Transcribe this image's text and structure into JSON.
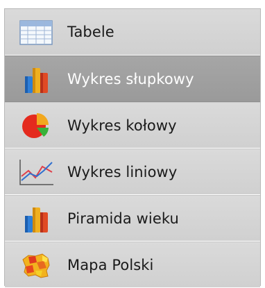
{
  "menu": {
    "active_index": 1,
    "items": [
      {
        "label": "Tabele",
        "icon": "table-icon"
      },
      {
        "label": "Wykres słupkowy",
        "icon": "bar-chart-icon"
      },
      {
        "label": "Wykres kołowy",
        "icon": "pie-chart-icon"
      },
      {
        "label": "Wykres liniowy",
        "icon": "line-chart-icon"
      },
      {
        "label": "Piramida wieku",
        "icon": "bar-chart-icon"
      },
      {
        "label": "Mapa Polski",
        "icon": "poland-map-icon"
      }
    ]
  },
  "colors": {
    "active_background": "#a0a0a0",
    "item_background": "#d4d4d4",
    "active_text": "#ffffff",
    "item_text": "#1a1a1a"
  }
}
